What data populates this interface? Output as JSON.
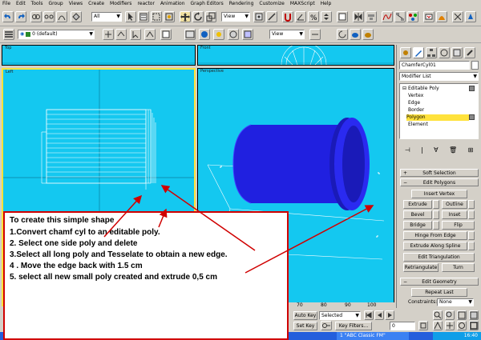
{
  "menu": [
    "File",
    "Edit",
    "Tools",
    "Group",
    "Views",
    "Create",
    "Modifiers",
    "reactor",
    "Animation",
    "Graph Editors",
    "Rendering",
    "Customize",
    "MAXScript",
    "Help"
  ],
  "toolbar": {
    "selection_filter": "All",
    "ref_coord": "View",
    "layer": "0 (default)",
    "view2": "View"
  },
  "viewports": {
    "top": "Top",
    "front": "Front",
    "left": "Left",
    "perspective": "Perspective"
  },
  "command_panel": {
    "object_name": "ChamferCyl01",
    "modifier_list": "Modifier List",
    "stack": [
      "Editable Poly",
      "Vertex",
      "Edge",
      "Border",
      "Polygon",
      "Element"
    ],
    "soft_selection": "Soft Selection",
    "edit_polygons": "Edit Polygons",
    "insert_vertex": "Insert Vertex",
    "extrude": "Extrude",
    "outline": "Outline",
    "bevel": "Bevel",
    "inset": "Inset",
    "bridge": "Bridge",
    "flip": "Flip",
    "hinge_from_edge": "Hinge From Edge",
    "extrude_along_spline": "Extrude Along Spline",
    "edit_triangulation": "Edit Triangulation",
    "retriangulate": "Retriangulate",
    "turn": "Turn",
    "edit_geometry": "Edit Geometry",
    "repeat_last": "Repeat Last",
    "constraints_label": "Constraints:",
    "constraints_value": "None"
  },
  "timeline": {
    "ticks": [
      "70",
      "80",
      "90",
      "100"
    ],
    "auto_key": "Auto Key",
    "selected": "Selected",
    "set_key": "Set Key",
    "key_filters": "Key Filters...",
    "frame": "0"
  },
  "taskbar": {
    "item": "1  \"ABC Classic FM\"",
    "time": "16:40"
  },
  "note": {
    "title": "To create this simple shape",
    "step1": "1.Convert chamf cyl to an editable poly.",
    "step2": "2. Select one side poly and delete",
    "step3": "3.Select all long poly and Tesselate to obtain a new edge.",
    "step4": "4 . Move the edge back with 1.5 cm",
    "step5": "5. select all new small poly created and extrude 0,5 cm"
  },
  "colors": {
    "viewport_bg": "#14c8f0",
    "object_blue": "#2020e0",
    "annotation_red": "#d00000",
    "active_border": "#ffe23c"
  }
}
